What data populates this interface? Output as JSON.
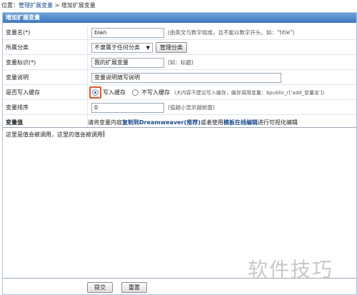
{
  "breadcrumb": {
    "prefix": "位置：",
    "link": "管理扩展变量",
    "separator": " > ",
    "current": "增加扩展变量"
  },
  "panel": {
    "title": "增加扩展变量"
  },
  "form": {
    "var_name": {
      "label": "变量名(*)",
      "value": "bian",
      "hint": "(由英文与数字组成，且不能以数字开头。如：\"title\")"
    },
    "category": {
      "label": "所属分类",
      "selected": "不隶属于任何分类",
      "manage_button": "管理分类"
    },
    "var_title": {
      "label": "变量标识(*)",
      "value": "我的扩展变量",
      "hint": "(如：标题)"
    },
    "var_desc": {
      "label": "变量说明",
      "value": "变量说明填写说明"
    },
    "cache": {
      "label": "是否写入缓存",
      "option_yes": "写入缓存",
      "option_no": "不写入缓存",
      "hint": "(大内容不建议写入缓存，缓存调用变量：$public_r['add_变量名'])",
      "selected": "yes"
    },
    "sort": {
      "label": "变量排序",
      "value": "0",
      "hint": "(值越小显示越前面)"
    },
    "value": {
      "label": "变量值",
      "tip_before": "请将变量内容",
      "tip_link1": "复制到Dreamweaver(推荐)",
      "tip_middle": "或者使用",
      "tip_link2": "模板在线编辑",
      "tip_after": "进行可视化编辑",
      "content": "这里是值会被调用，这里的值会被调用"
    }
  },
  "buttons": {
    "submit": "提交",
    "reset": "重置"
  },
  "watermark": "软件技巧"
}
